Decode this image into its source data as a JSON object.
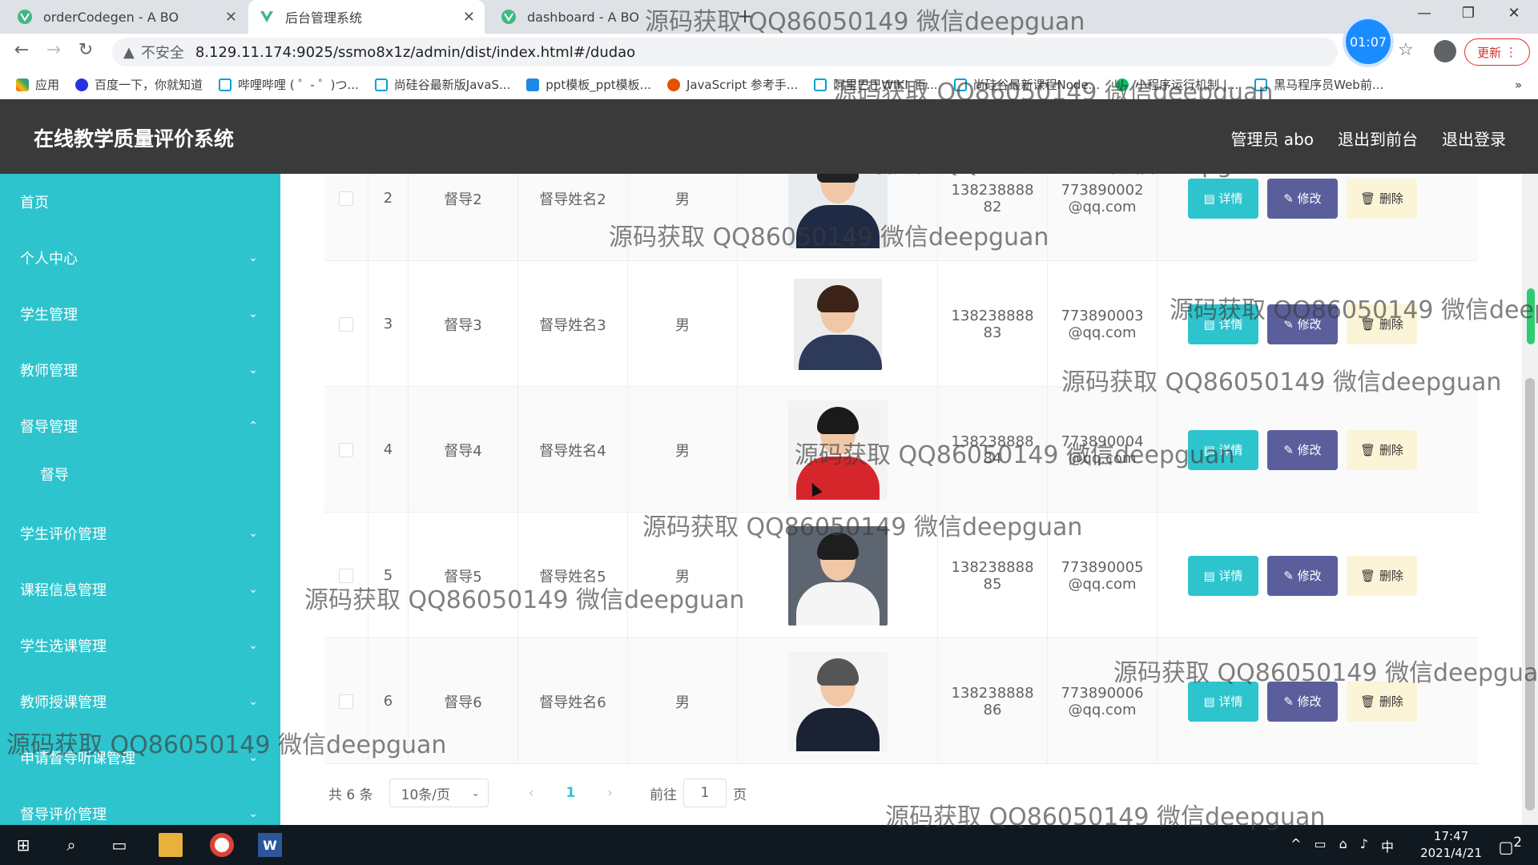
{
  "browser": {
    "tabs": [
      {
        "title": "orderCodegen - A BO",
        "active": false
      },
      {
        "title": "后台管理系统",
        "active": true
      },
      {
        "title": "dashboard - A BO",
        "active": false
      }
    ],
    "security_label": "不安全",
    "url": "8.129.11.174:9025/ssmo8x1z/admin/dist/index.html#/dudao",
    "timer": "01:07",
    "update_label": "更新",
    "bookmarks": [
      "应用",
      "百度一下，你就知道",
      "哔哩哔哩 ( ゜- ゜)つ...",
      "尚硅谷最新版JavaS...",
      "ppt模板_ppt模板...",
      "JavaScript 参考手...",
      "阿里巴巴WIKI_百...",
      "尚硅谷最新课程Node...",
      "小程序运行机制 |...",
      "黑马程序员Web前..."
    ],
    "more_label": "»"
  },
  "header": {
    "title": "在线教学质量评价系统",
    "links": [
      "管理员 abo",
      "退出到前台",
      "退出登录"
    ]
  },
  "sidebar": {
    "items": [
      {
        "label": "首页",
        "chevron": ""
      },
      {
        "label": "个人中心",
        "chevron": "⌄"
      },
      {
        "label": "学生管理",
        "chevron": "⌄"
      },
      {
        "label": "教师管理",
        "chevron": "⌄"
      },
      {
        "label": "督导管理",
        "chevron": "⌃"
      },
      {
        "label": "督导",
        "chevron": ""
      },
      {
        "label": "学生评价管理",
        "chevron": "⌄"
      },
      {
        "label": "课程信息管理",
        "chevron": "⌄"
      },
      {
        "label": "学生选课管理",
        "chevron": "⌄"
      },
      {
        "label": "教师授课管理",
        "chevron": "⌄"
      },
      {
        "label": "申请督导听课管理",
        "chevron": "⌄"
      },
      {
        "label": "督导评价管理",
        "chevron": "⌄"
      }
    ]
  },
  "table": {
    "rows": [
      {
        "no": "2",
        "account": "督导2",
        "name": "督导姓名2",
        "gender": "男",
        "phone": "13823888882",
        "email": "773890002@qq.com"
      },
      {
        "no": "3",
        "account": "督导3",
        "name": "督导姓名3",
        "gender": "男",
        "phone": "13823888883",
        "email": "773890003@qq.com"
      },
      {
        "no": "4",
        "account": "督导4",
        "name": "督导姓名4",
        "gender": "男",
        "phone": "13823888884",
        "email": "773890004@qq.com"
      },
      {
        "no": "5",
        "account": "督导5",
        "name": "督导姓名5",
        "gender": "男",
        "phone": "13823888885",
        "email": "773890005@qq.com"
      },
      {
        "no": "6",
        "account": "督导6",
        "name": "督导姓名6",
        "gender": "男",
        "phone": "13823888886",
        "email": "773890006@qq.com"
      }
    ],
    "actions": {
      "detail": "详情",
      "edit": "修改",
      "delete": "删除"
    }
  },
  "pagination": {
    "total": "共 6 条",
    "page_size": "10条/页",
    "current_page": "1",
    "goto_label": "前往",
    "goto_value": "1",
    "page_unit": "页"
  },
  "taskbar": {
    "time": "17:47",
    "date": "2021/4/21",
    "ime": "中",
    "notifications": "2"
  },
  "watermark": "源码获取 QQ86050149 微信deepguan",
  "colors": {
    "sidebar": "#2ec4cd",
    "header": "#3a3a3a",
    "detail_button": "#2ec4cd",
    "edit_button": "#5a5f9c",
    "delete_button": "#fcf4d6"
  }
}
